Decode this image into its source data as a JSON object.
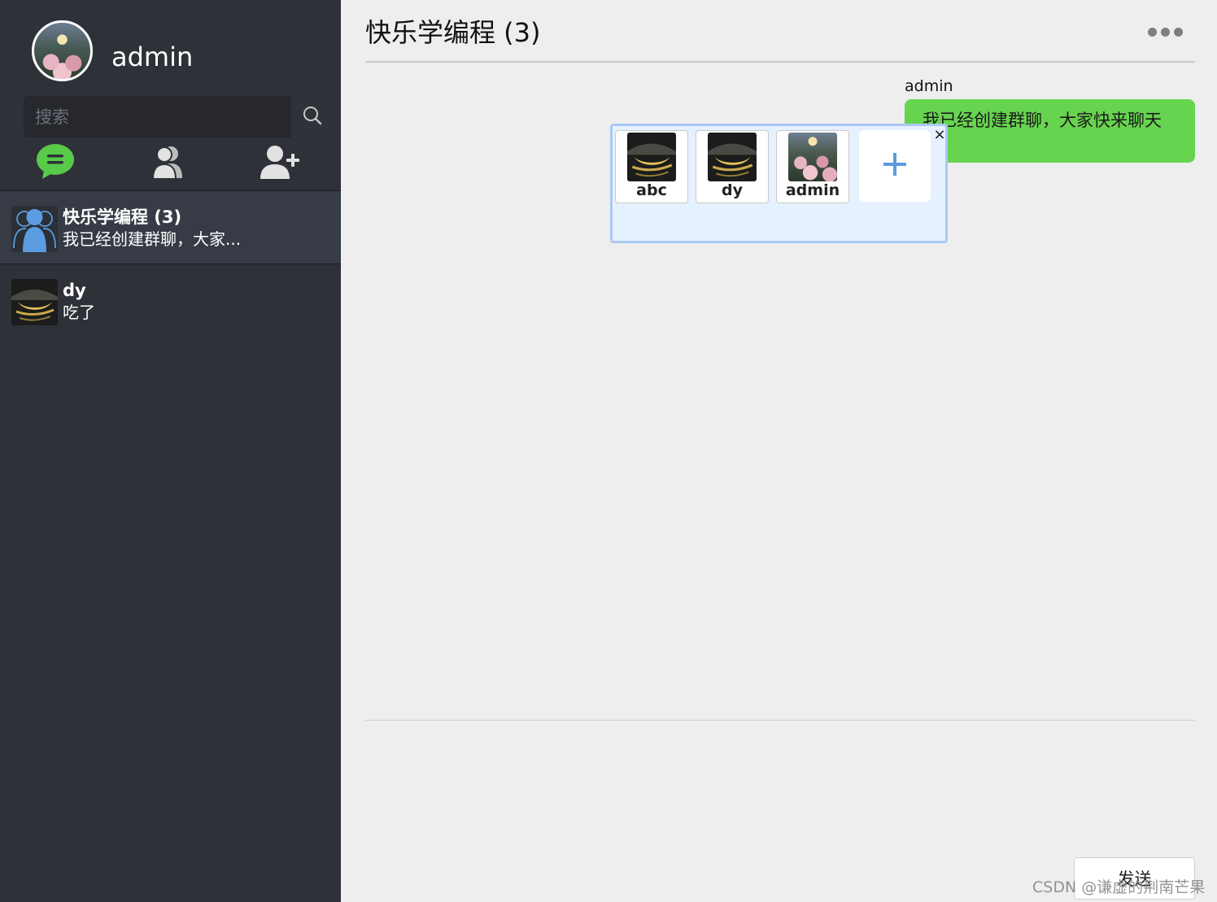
{
  "user": {
    "name": "admin",
    "avatar_icon": "flower-garden-photo"
  },
  "search": {
    "placeholder": "搜索",
    "button_icon": "search-icon"
  },
  "nav": [
    {
      "name": "chats",
      "icon": "chat-bubble-icon",
      "color": "#59c94a"
    },
    {
      "name": "contacts",
      "icon": "contacts-icon",
      "color": "#d9d9d9"
    },
    {
      "name": "add-friend",
      "icon": "add-user-icon",
      "color": "#d9d9d9"
    }
  ],
  "conversations": [
    {
      "title": "快乐学编程 (3)",
      "preview": "我已经创建群聊，大家...",
      "avatar_icon": "group-icon",
      "active": true
    },
    {
      "title": "dy",
      "preview": "吃了",
      "avatar_icon": "moon-bridge-photo",
      "active": false
    }
  ],
  "chat": {
    "title": "快乐学编程 (3)",
    "more_icon": "more-dots-icon",
    "messages": [
      {
        "sender": "admin",
        "text": "我已经创建群聊，大家快来聊天"
      }
    ],
    "send_label": "发送"
  },
  "members_popup": {
    "close_label": "×",
    "members": [
      {
        "name": "abc",
        "avatar_icon": "moon-bridge-photo"
      },
      {
        "name": "dy",
        "avatar_icon": "moon-bridge-photo"
      },
      {
        "name": "admin",
        "avatar_icon": "flower-garden-photo"
      }
    ],
    "add_label": "+"
  },
  "watermark": "CSDN @谦虚的荆南芒果",
  "colors": {
    "sidebar_bg": "#2e3138",
    "active_item_bg": "#363b45",
    "bubble_green": "#67d44f",
    "popup_bg": "#e6f1ff",
    "accent_blue": "#5b9be0"
  }
}
